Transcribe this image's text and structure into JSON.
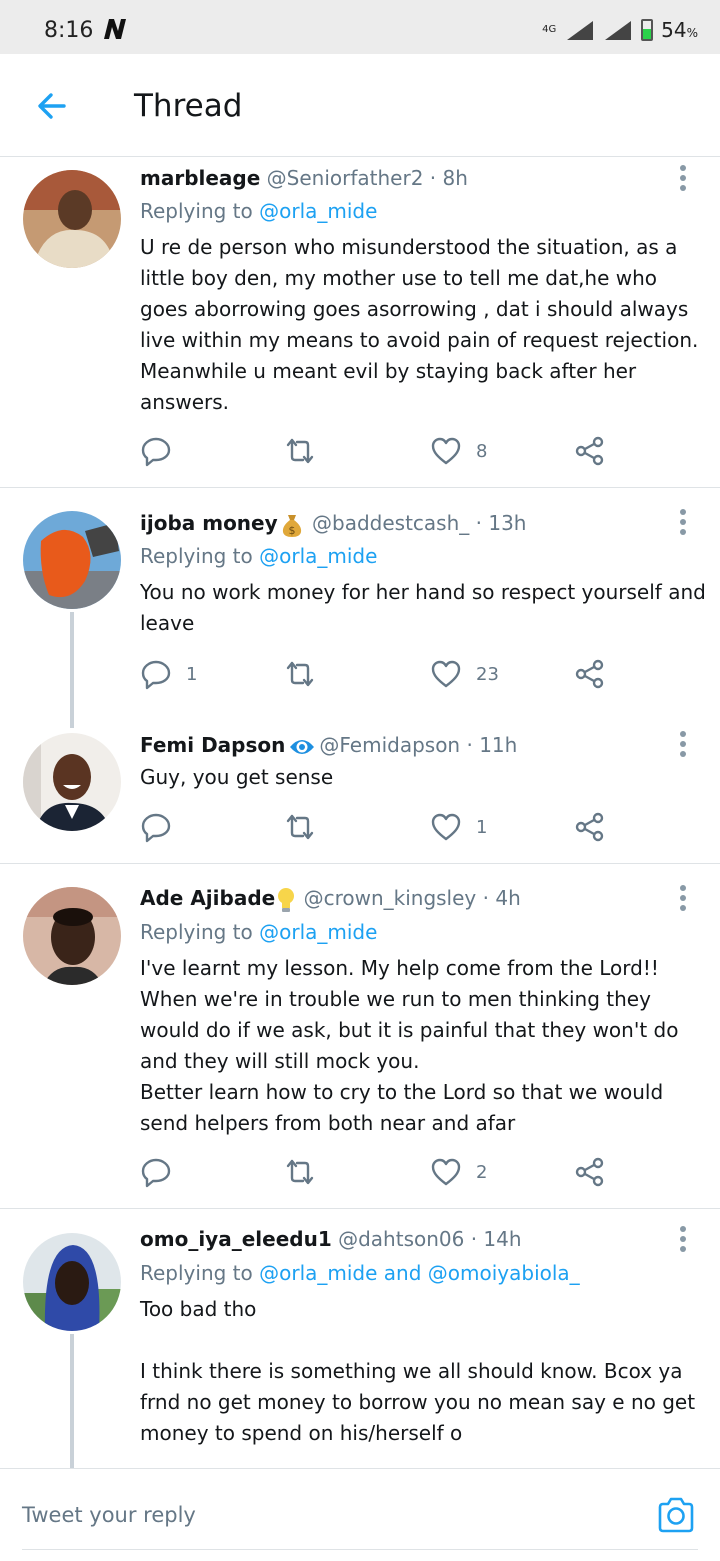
{
  "status": {
    "time": "8:16",
    "network": "4G",
    "battery": "54",
    "battery_unit": "%"
  },
  "header": {
    "title": "Thread"
  },
  "tweets": [
    {
      "name": "marbleage",
      "handle": "@Seniorfather2",
      "dot": "·",
      "time": "8h",
      "replying_prefix": "Replying to ",
      "replying_to": "@orla_mide",
      "text": "U re de person who misunderstood the situation, as a little boy den, my mother use to tell me dat,he who goes aborrowing goes asorrowing , dat i should always live within my means to avoid pain of request rejection. Meanwhile u meant evil by staying back after her answers.",
      "replies": "",
      "retweets": "",
      "likes": "8"
    },
    {
      "name": "ijoba money",
      "handle": "@baddestcash_",
      "dot": "·",
      "time": "13h",
      "replying_prefix": "Replying to ",
      "replying_to": "@orla_mide",
      "text": "You no work money for her hand so respect yourself and leave",
      "replies": "1",
      "retweets": "",
      "likes": "23"
    },
    {
      "name": "Femi Dapson",
      "handle": "@Femidapson",
      "dot": "·",
      "time": "11h",
      "text": "Guy, you get sense",
      "replies": "",
      "retweets": "",
      "likes": "1"
    },
    {
      "name": "Ade Ajibade",
      "handle": "@crown_kingsley",
      "dot": "·",
      "time": "4h",
      "replying_prefix": "Replying to ",
      "replying_to": "@orla_mide",
      "text": "I've learnt my lesson. My help come from the Lord!!\nWhen we're in trouble we run to men thinking they would do if we ask, but it is painful that they won't do and they will still mock you.\nBetter learn how to cry to the Lord so that we would send helpers from both near and afar",
      "replies": "",
      "retweets": "",
      "likes": "2"
    },
    {
      "name": "omo_iya_eleedu1",
      "handle": "@dahtson06",
      "dot": "·",
      "time": "14h",
      "replying_prefix": "Replying to ",
      "replying_to": "@orla_mide",
      "replying_and": " and ",
      "replying_to_2": "@omoiyabiola_",
      "text": "Too bad tho\n\nI think there is something we all should know. Bcox ya frnd no get money to borrow you no mean say e no get money to spend on his/herself o"
    }
  ],
  "composer": {
    "placeholder": "Tweet your reply"
  },
  "colors": {
    "accent": "#1da1f2",
    "secondary_text": "#657786",
    "thread_line": "#c9d1d8"
  },
  "icons": {
    "back": "arrow-left-icon",
    "reply": "speech-bubble-icon",
    "retweet": "retweet-icon",
    "like": "heart-icon",
    "share": "share-icon",
    "more": "vertical-dots-icon",
    "camera": "camera-icon",
    "verified": "eye-badge-icon",
    "money_bag": "money-bag-icon",
    "bulb": "lightbulb-icon"
  }
}
